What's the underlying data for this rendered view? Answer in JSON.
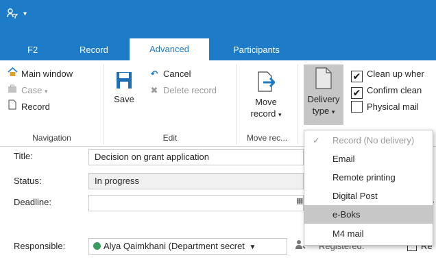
{
  "quick_access": {
    "icon": "people-filter-icon",
    "arrow": "▾"
  },
  "tabs": [
    {
      "label": "F2"
    },
    {
      "label": "Record"
    },
    {
      "label": "Advanced"
    },
    {
      "label": "Participants"
    }
  ],
  "ribbon": {
    "navigation": {
      "main_window": "Main window",
      "case": "Case",
      "case_caret": "▾",
      "record": "Record",
      "label": "Navigation"
    },
    "edit": {
      "save": "Save",
      "cancel": "Cancel",
      "delete_record": "Delete record",
      "label": "Edit"
    },
    "move": {
      "line1": "Move",
      "line2": "record",
      "caret": "▾",
      "label": "Move rec..."
    },
    "delivery": {
      "line1": "Delivery",
      "line2": "type",
      "caret": "▾"
    },
    "options": {
      "clean_up": "Clean up wher",
      "confirm_clean": "Confirm clean",
      "physical_mail": "Physical mail"
    }
  },
  "form": {
    "title_label": "Title:",
    "title_value": "Decision on grant application",
    "status_label": "Status:",
    "status_value": "In progress",
    "deadline_label": "Deadline:",
    "deadline_value": "",
    "deadline_trail": "e",
    "responsible_label": "Responsible:",
    "responsible_value": "Alya Qaimkhani (Department secret",
    "responsible_caret": "▼",
    "registered_label": "Registered:",
    "registered_trail": "Re"
  },
  "delivery_menu": {
    "items": [
      {
        "label": "Record (No delivery)",
        "checked": true
      },
      {
        "label": "Email"
      },
      {
        "label": "Remote printing"
      },
      {
        "label": "Digital Post"
      },
      {
        "label": "e-Boks"
      },
      {
        "label": "M4 mail"
      }
    ],
    "check_mark": "✓",
    "highlighted_index": 4
  },
  "colors": {
    "brand_blue": "#1e7bc7",
    "highlight_grey": "#c7c7c7",
    "status_green": "#3a9b5c"
  }
}
